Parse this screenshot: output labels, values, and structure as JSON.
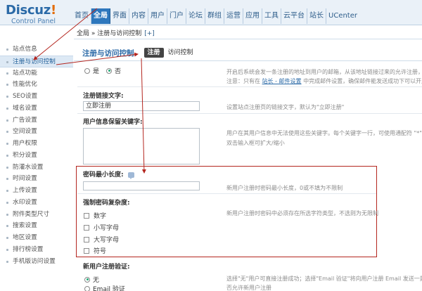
{
  "brand": {
    "name": "Discuz",
    "bang": "!",
    "subtitle": "Control Panel"
  },
  "nav": [
    "首页",
    "全局",
    "界面",
    "内容",
    "用户",
    "门户",
    "论坛",
    "群组",
    "运营",
    "应用",
    "工具",
    "云平台",
    "站长",
    "UCenter"
  ],
  "nav_active_index": 1,
  "breadcrumb": {
    "text": "全局 » 注册与访问控制",
    "plus": "[+]"
  },
  "sidebar": {
    "items": [
      "站点信息",
      "注册与访问控制",
      "站点功能",
      "性能优化",
      "SEO设置",
      "域名设置",
      "广告设置",
      "空间设置",
      "用户权限",
      "积分设置",
      "防灌水设置",
      "时间设置",
      "上传设置",
      "水印设置",
      "附件类型尺寸",
      "搜索设置",
      "地区设置",
      "排行榜设置",
      "手机版访问设置"
    ],
    "active_index": 1
  },
  "page": {
    "title": "注册与访问控制",
    "tabs": [
      "注册",
      "访问控制"
    ],
    "active_tab_index": 0
  },
  "form": {
    "register_open": {
      "options": [
        "是",
        "否"
      ],
      "selected_index": 1,
      "desc_line1": "开启后系统会发一条注册的地址到用户的邮箱，从该地址链接过来的允许注册，同",
      "desc_line2_pre": "注意：只有在 ",
      "desc_line2_link": "站长 - 邮件设置",
      "desc_line2_post": " 中完成邮件设置，确保邮件能发送成功下可以开启"
    },
    "register_link_text": {
      "label": "注册链接文字:",
      "value": "立即注册",
      "desc": "设置站点注册页的链接文字，默认为\"立即注册\""
    },
    "reserved_keywords": {
      "label": "用户信息保留关键字:",
      "value": "",
      "desc_line1": "用户在其用户信息中无法使用这些关键字。每个关键字一行，可使用通配符 \"*\" 如",
      "desc_line2": "双击输入框可扩大/缩小"
    },
    "pwd_min_length": {
      "label": "密码最小长度:",
      "value": "",
      "desc": "新用户注册时密码最小长度，0或不填为不限制"
    },
    "pwd_complexity": {
      "label": "强制密码复杂度:",
      "desc": "新用户注册时密码中必须存在所选字符类型，不选则为无限制",
      "options": [
        "数字",
        "小写字母",
        "大写字母",
        "符号"
      ]
    },
    "register_verify": {
      "label": "新用户注册验证:",
      "options": [
        "无",
        "Email 验证"
      ],
      "selected_index": 0,
      "desc_line1": "选择\"无\"用户可直接注册成功；选择\"Email 验证\"将向用户注册 Email 发送一封",
      "desc_line2": "否允许新用户注册"
    }
  },
  "colors": {
    "accent": "#2b6aa7",
    "annotation": "#b4261f",
    "nav_active": "#2d77bd"
  }
}
